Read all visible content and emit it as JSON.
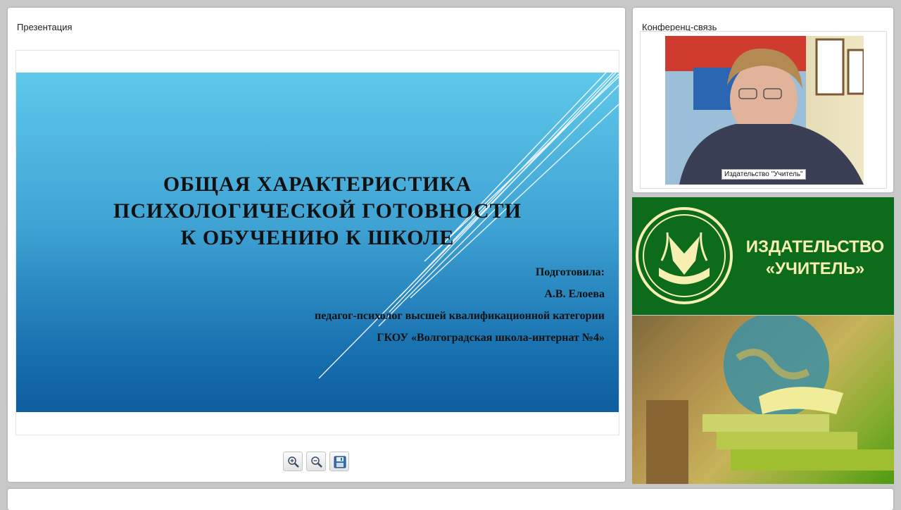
{
  "presentation": {
    "panel_title": "Презентация",
    "slide": {
      "title_lines": [
        "ОБЩАЯ ХАРАКТЕРИСТИКА",
        "ПСИХОЛОГИЧЕСКОЙ ГОТОВНОСТИ",
        "К ОБУЧЕНИЮ К ШКОЛЕ"
      ],
      "prepared_by": "Подготовила:",
      "author": "А.В. Елоева",
      "position": "педагог-психолог высшей квалификационной категории",
      "organization": "ГКОУ «Волгоградская школа-интернат №4»"
    },
    "toolbar": {
      "zoom_in_icon": "zoom-in-icon",
      "zoom_out_icon": "zoom-out-icon",
      "save_icon": "floppy-disk-icon"
    }
  },
  "conference": {
    "panel_title": "Конференц-связь",
    "participant_name": "Издательство \"Учитель\""
  },
  "banner": {
    "line1": "ИЗДАТЕЛЬСТВО",
    "line2": "«УЧИТЕЛЬ»",
    "colors": {
      "background": "#0d6b1c",
      "text": "#f7efb1"
    }
  },
  "colors": {
    "page_background": "#c7c7c7",
    "slide_top": "#5fc8ea",
    "slide_bottom": "#0d5d9f"
  }
}
